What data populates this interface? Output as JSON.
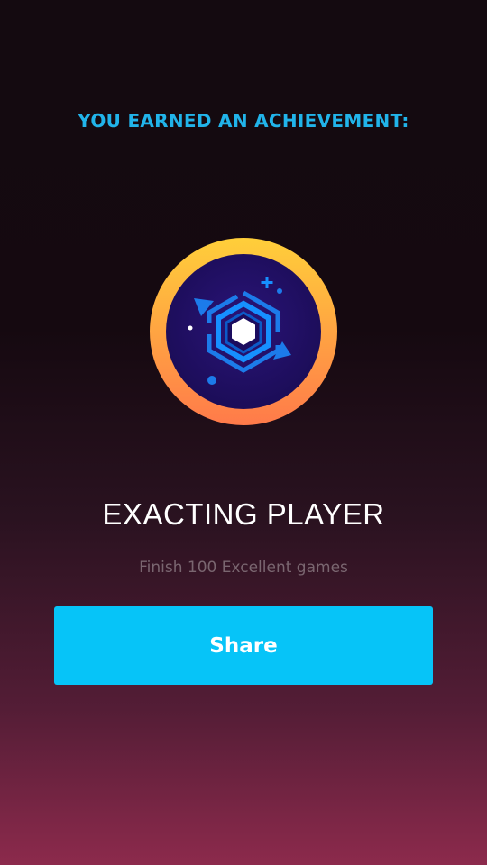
{
  "achievement": {
    "heading": "YOU EARNED AN ACHIEVEMENT:",
    "title": "EXACTING PLAYER",
    "description": "Finish 100 Excellent games",
    "badge_icon": "hexagon-cube-badge-icon"
  },
  "actions": {
    "share_label": "Share"
  },
  "colors": {
    "heading": "#21b4ea",
    "button": "#06c4f8",
    "ring_top": "#ffcf3a",
    "ring_bottom": "#ff7a4a",
    "badge_inner": "#22116a"
  }
}
